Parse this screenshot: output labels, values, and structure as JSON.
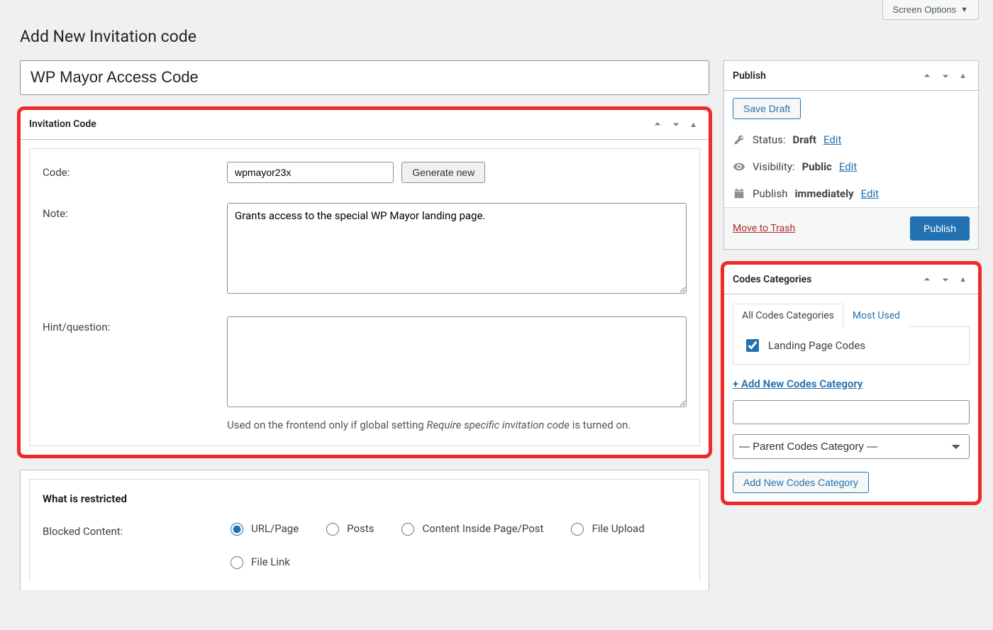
{
  "screenOptions": {
    "label": "Screen Options"
  },
  "pageTitle": "Add New Invitation code",
  "titleInputValue": "WP Mayor Access Code",
  "invitationBox": {
    "heading": "Invitation Code",
    "codeLabel": "Code:",
    "codeValue": "wpmayor23x",
    "generateBtn": "Generate new",
    "noteLabel": "Note:",
    "noteValue": "Grants access to the special WP Mayor landing page.",
    "hintLabel": "Hint/question:",
    "hintValue": "",
    "hintHelpPrefix": "Used on the frontend only if global setting ",
    "hintHelpEm": "Require specific invitation code",
    "hintHelpSuffix": " is turned on."
  },
  "restricted": {
    "heading": "What is restricted",
    "label": "Blocked Content:",
    "options": [
      "URL/Page",
      "Posts",
      "Content Inside Page/Post",
      "File Upload",
      "File Link"
    ]
  },
  "publish": {
    "heading": "Publish",
    "saveDraft": "Save Draft",
    "statusLabel": "Status: ",
    "statusValue": "Draft",
    "visibilityLabel": "Visibility: ",
    "visibilityValue": "Public",
    "publishLabel": "Publish ",
    "publishValue": "immediately",
    "edit": "Edit",
    "trash": "Move to Trash",
    "publishBtn": "Publish"
  },
  "categories": {
    "heading": "Codes Categories",
    "tabAll": "All Codes Categories",
    "tabMost": "Most Used",
    "item": "Landing Page Codes",
    "addLink": "+ Add New Codes Category",
    "parentSelect": "— Parent Codes Category —",
    "addBtn": "Add New Codes Category"
  }
}
